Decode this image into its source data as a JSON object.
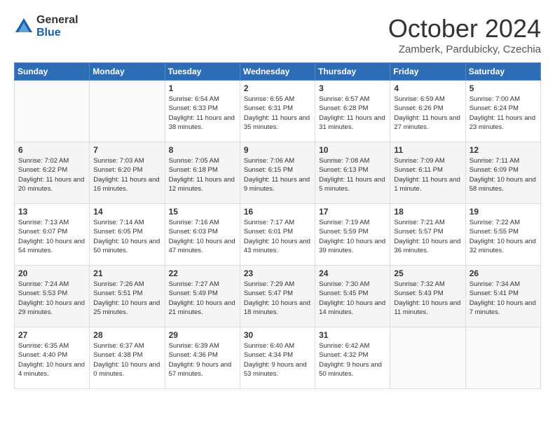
{
  "header": {
    "logo_general": "General",
    "logo_blue": "Blue",
    "month_title": "October 2024",
    "location": "Zamberk, Pardubicky, Czechia"
  },
  "days_of_week": [
    "Sunday",
    "Monday",
    "Tuesday",
    "Wednesday",
    "Thursday",
    "Friday",
    "Saturday"
  ],
  "weeks": [
    [
      {
        "day": "",
        "info": ""
      },
      {
        "day": "",
        "info": ""
      },
      {
        "day": "1",
        "info": "Sunrise: 6:54 AM\nSunset: 6:33 PM\nDaylight: 11 hours\nand 38 minutes."
      },
      {
        "day": "2",
        "info": "Sunrise: 6:55 AM\nSunset: 6:31 PM\nDaylight: 11 hours\nand 35 minutes."
      },
      {
        "day": "3",
        "info": "Sunrise: 6:57 AM\nSunset: 6:28 PM\nDaylight: 11 hours\nand 31 minutes."
      },
      {
        "day": "4",
        "info": "Sunrise: 6:59 AM\nSunset: 6:26 PM\nDaylight: 11 hours\nand 27 minutes."
      },
      {
        "day": "5",
        "info": "Sunrise: 7:00 AM\nSunset: 6:24 PM\nDaylight: 11 hours\nand 23 minutes."
      }
    ],
    [
      {
        "day": "6",
        "info": "Sunrise: 7:02 AM\nSunset: 6:22 PM\nDaylight: 11 hours\nand 20 minutes."
      },
      {
        "day": "7",
        "info": "Sunrise: 7:03 AM\nSunset: 6:20 PM\nDaylight: 11 hours\nand 16 minutes."
      },
      {
        "day": "8",
        "info": "Sunrise: 7:05 AM\nSunset: 6:18 PM\nDaylight: 11 hours\nand 12 minutes."
      },
      {
        "day": "9",
        "info": "Sunrise: 7:06 AM\nSunset: 6:15 PM\nDaylight: 11 hours\nand 9 minutes."
      },
      {
        "day": "10",
        "info": "Sunrise: 7:08 AM\nSunset: 6:13 PM\nDaylight: 11 hours\nand 5 minutes."
      },
      {
        "day": "11",
        "info": "Sunrise: 7:09 AM\nSunset: 6:11 PM\nDaylight: 11 hours\nand 1 minute."
      },
      {
        "day": "12",
        "info": "Sunrise: 7:11 AM\nSunset: 6:09 PM\nDaylight: 10 hours\nand 58 minutes."
      }
    ],
    [
      {
        "day": "13",
        "info": "Sunrise: 7:13 AM\nSunset: 6:07 PM\nDaylight: 10 hours\nand 54 minutes."
      },
      {
        "day": "14",
        "info": "Sunrise: 7:14 AM\nSunset: 6:05 PM\nDaylight: 10 hours\nand 50 minutes."
      },
      {
        "day": "15",
        "info": "Sunrise: 7:16 AM\nSunset: 6:03 PM\nDaylight: 10 hours\nand 47 minutes."
      },
      {
        "day": "16",
        "info": "Sunrise: 7:17 AM\nSunset: 6:01 PM\nDaylight: 10 hours\nand 43 minutes."
      },
      {
        "day": "17",
        "info": "Sunrise: 7:19 AM\nSunset: 5:59 PM\nDaylight: 10 hours\nand 39 minutes."
      },
      {
        "day": "18",
        "info": "Sunrise: 7:21 AM\nSunset: 5:57 PM\nDaylight: 10 hours\nand 36 minutes."
      },
      {
        "day": "19",
        "info": "Sunrise: 7:22 AM\nSunset: 5:55 PM\nDaylight: 10 hours\nand 32 minutes."
      }
    ],
    [
      {
        "day": "20",
        "info": "Sunrise: 7:24 AM\nSunset: 5:53 PM\nDaylight: 10 hours\nand 29 minutes."
      },
      {
        "day": "21",
        "info": "Sunrise: 7:26 AM\nSunset: 5:51 PM\nDaylight: 10 hours\nand 25 minutes."
      },
      {
        "day": "22",
        "info": "Sunrise: 7:27 AM\nSunset: 5:49 PM\nDaylight: 10 hours\nand 21 minutes."
      },
      {
        "day": "23",
        "info": "Sunrise: 7:29 AM\nSunset: 5:47 PM\nDaylight: 10 hours\nand 18 minutes."
      },
      {
        "day": "24",
        "info": "Sunrise: 7:30 AM\nSunset: 5:45 PM\nDaylight: 10 hours\nand 14 minutes."
      },
      {
        "day": "25",
        "info": "Sunrise: 7:32 AM\nSunset: 5:43 PM\nDaylight: 10 hours\nand 11 minutes."
      },
      {
        "day": "26",
        "info": "Sunrise: 7:34 AM\nSunset: 5:41 PM\nDaylight: 10 hours\nand 7 minutes."
      }
    ],
    [
      {
        "day": "27",
        "info": "Sunrise: 6:35 AM\nSunset: 4:40 PM\nDaylight: 10 hours\nand 4 minutes."
      },
      {
        "day": "28",
        "info": "Sunrise: 6:37 AM\nSunset: 4:38 PM\nDaylight: 10 hours\nand 0 minutes."
      },
      {
        "day": "29",
        "info": "Sunrise: 6:39 AM\nSunset: 4:36 PM\nDaylight: 9 hours\nand 57 minutes."
      },
      {
        "day": "30",
        "info": "Sunrise: 6:40 AM\nSunset: 4:34 PM\nDaylight: 9 hours\nand 53 minutes."
      },
      {
        "day": "31",
        "info": "Sunrise: 6:42 AM\nSunset: 4:32 PM\nDaylight: 9 hours\nand 50 minutes."
      },
      {
        "day": "",
        "info": ""
      },
      {
        "day": "",
        "info": ""
      }
    ]
  ]
}
